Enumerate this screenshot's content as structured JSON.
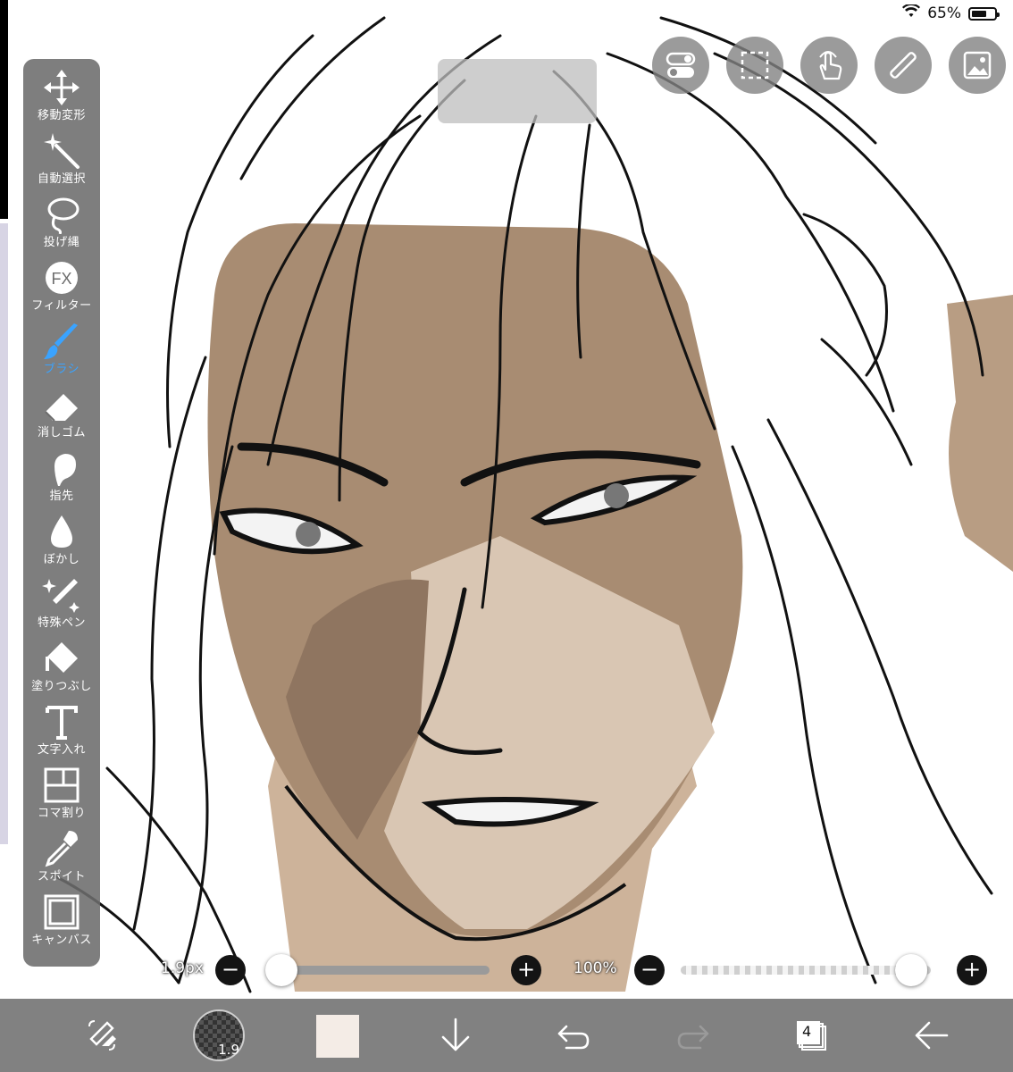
{
  "status": {
    "battery_text": "65%",
    "battery_level": 0.65,
    "wifi_icon": "wifi-icon"
  },
  "zoom_indicator": {
    "text": ""
  },
  "tools": [
    {
      "key": "move",
      "label": "移動変形",
      "icon": "move-arrows-icon",
      "active": false
    },
    {
      "key": "magic",
      "label": "自動選択",
      "icon": "magic-wand-icon",
      "active": false
    },
    {
      "key": "lasso",
      "label": "投げ縄",
      "icon": "lasso-icon",
      "active": false
    },
    {
      "key": "filter",
      "label": "フィルター",
      "icon": "fx-filter-icon",
      "active": false
    },
    {
      "key": "brush",
      "label": "ブラシ",
      "icon": "brush-icon",
      "active": true
    },
    {
      "key": "eraser",
      "label": "消しゴム",
      "icon": "eraser-icon",
      "active": false
    },
    {
      "key": "smudge",
      "label": "指先",
      "icon": "smudge-finger-icon",
      "active": false
    },
    {
      "key": "blur",
      "label": "ぼかし",
      "icon": "blur-drop-icon",
      "active": false
    },
    {
      "key": "special",
      "label": "特殊ペン",
      "icon": "special-pen-icon",
      "active": false
    },
    {
      "key": "fill",
      "label": "塗りつぶし",
      "icon": "bucket-fill-icon",
      "active": false
    },
    {
      "key": "text",
      "label": "文字入れ",
      "icon": "text-t-icon",
      "active": false
    },
    {
      "key": "frame",
      "label": "コマ割り",
      "icon": "frame-divider-icon",
      "active": false
    },
    {
      "key": "dropper",
      "label": "スポイト",
      "icon": "eyedropper-icon",
      "active": false
    },
    {
      "key": "canvas",
      "label": "キャンバス",
      "icon": "canvas-square-icon",
      "active": false
    }
  ],
  "top_buttons": [
    {
      "name": "toggle-settings-button",
      "icon": "toggle-switches-icon"
    },
    {
      "name": "selection-button",
      "icon": "dashed-selection-icon"
    },
    {
      "name": "gesture-button",
      "icon": "touch-hand-icon"
    },
    {
      "name": "ruler-button",
      "icon": "ruler-pen-icon"
    },
    {
      "name": "material-button",
      "icon": "image-material-icon"
    }
  ],
  "brush_size": {
    "text": "1.9px",
    "level": 0.0
  },
  "opacity": {
    "text": "100%",
    "level": 1.0
  },
  "bottom": {
    "brush_badge": "1.9",
    "layer_count": "4",
    "color": "#f4ece6",
    "icons": [
      "swap-tools-icon",
      "brush-size-icon",
      "color-swatch-icon",
      "download-arrow-icon",
      "undo-icon",
      "redo-icon",
      "layers-icon",
      "back-arrow-icon"
    ]
  }
}
